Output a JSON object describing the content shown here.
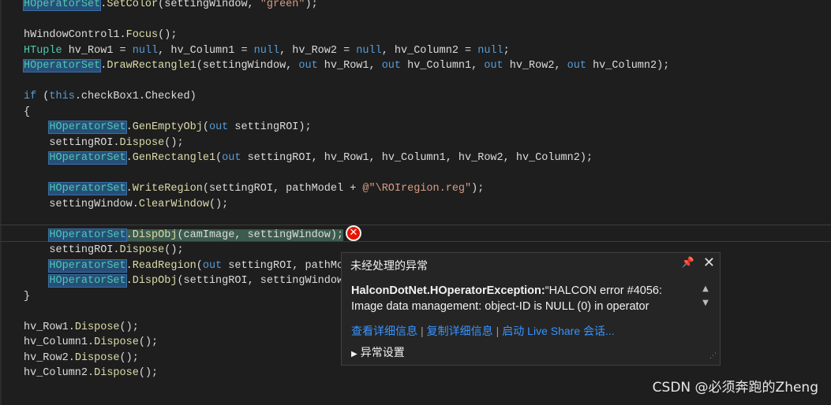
{
  "editor": {
    "lines": [
      {
        "t": [
          {
            "c": "hl-box tok-type",
            "v": "HOperatorSet"
          },
          {
            "c": "tok-plain",
            "v": "."
          },
          {
            "c": "tok-method",
            "v": "SetColor"
          },
          {
            "c": "tok-plain",
            "v": "(settingWindow, "
          },
          {
            "c": "tok-str",
            "v": "\"green\""
          },
          {
            "c": "tok-plain",
            "v": ");"
          }
        ]
      },
      {
        "t": []
      },
      {
        "t": [
          {
            "c": "tok-plain",
            "v": "hWindowControl1."
          },
          {
            "c": "tok-method",
            "v": "Focus"
          },
          {
            "c": "tok-plain",
            "v": "();"
          }
        ]
      },
      {
        "t": [
          {
            "c": "tok-type",
            "v": "HTuple"
          },
          {
            "c": "tok-plain",
            "v": " hv_Row1 = "
          },
          {
            "c": "tok-kw",
            "v": "null"
          },
          {
            "c": "tok-plain",
            "v": ", hv_Column1 = "
          },
          {
            "c": "tok-kw",
            "v": "null"
          },
          {
            "c": "tok-plain",
            "v": ", hv_Row2 = "
          },
          {
            "c": "tok-kw",
            "v": "null"
          },
          {
            "c": "tok-plain",
            "v": ", hv_Column2 = "
          },
          {
            "c": "tok-kw",
            "v": "null"
          },
          {
            "c": "tok-plain",
            "v": ";"
          }
        ]
      },
      {
        "t": [
          {
            "c": "hl-box tok-type",
            "v": "HOperatorSet"
          },
          {
            "c": "tok-plain",
            "v": "."
          },
          {
            "c": "tok-method",
            "v": "DrawRectangle1"
          },
          {
            "c": "tok-plain",
            "v": "(settingWindow, "
          },
          {
            "c": "tok-kw",
            "v": "out"
          },
          {
            "c": "tok-plain",
            "v": " hv_Row1, "
          },
          {
            "c": "tok-kw",
            "v": "out"
          },
          {
            "c": "tok-plain",
            "v": " hv_Column1, "
          },
          {
            "c": "tok-kw",
            "v": "out"
          },
          {
            "c": "tok-plain",
            "v": " hv_Row2, "
          },
          {
            "c": "tok-kw",
            "v": "out"
          },
          {
            "c": "tok-plain",
            "v": " hv_Column2);"
          }
        ]
      },
      {
        "t": []
      },
      {
        "t": [
          {
            "c": "tok-kw",
            "v": "if"
          },
          {
            "c": "tok-plain",
            "v": " ("
          },
          {
            "c": "tok-kw",
            "v": "this"
          },
          {
            "c": "tok-plain",
            "v": ".checkBox1.Checked)"
          }
        ]
      },
      {
        "t": [
          {
            "c": "tok-plain",
            "v": "{"
          }
        ]
      },
      {
        "t": [
          {
            "c": "tok-plain",
            "v": "    "
          },
          {
            "c": "hl-box tok-type",
            "v": "HOperatorSet"
          },
          {
            "c": "tok-plain",
            "v": "."
          },
          {
            "c": "tok-method",
            "v": "GenEmptyObj"
          },
          {
            "c": "tok-plain",
            "v": "("
          },
          {
            "c": "tok-kw",
            "v": "out"
          },
          {
            "c": "tok-plain",
            "v": " settingROI);"
          }
        ]
      },
      {
        "t": [
          {
            "c": "tok-plain",
            "v": "    settingROI."
          },
          {
            "c": "tok-method",
            "v": "Dispose"
          },
          {
            "c": "tok-plain",
            "v": "();"
          }
        ]
      },
      {
        "t": [
          {
            "c": "tok-plain",
            "v": "    "
          },
          {
            "c": "hl-box tok-type",
            "v": "HOperatorSet"
          },
          {
            "c": "tok-plain",
            "v": "."
          },
          {
            "c": "tok-method",
            "v": "GenRectangle1"
          },
          {
            "c": "tok-plain",
            "v": "("
          },
          {
            "c": "tok-kw",
            "v": "out"
          },
          {
            "c": "tok-plain",
            "v": " settingROI, hv_Row1, hv_Column1, hv_Row2, hv_Column2);"
          }
        ]
      },
      {
        "t": []
      },
      {
        "t": [
          {
            "c": "tok-plain",
            "v": "    "
          },
          {
            "c": "hl-box tok-type",
            "v": "HOperatorSet"
          },
          {
            "c": "tok-plain",
            "v": "."
          },
          {
            "c": "tok-method",
            "v": "WriteRegion"
          },
          {
            "c": "tok-plain",
            "v": "(settingROI, pathModel + "
          },
          {
            "c": "tok-str",
            "v": "@\"\\ROIregion.reg\""
          },
          {
            "c": "tok-plain",
            "v": ");"
          }
        ]
      },
      {
        "t": [
          {
            "c": "tok-plain",
            "v": "    settingWindow."
          },
          {
            "c": "tok-method",
            "v": "ClearWindow"
          },
          {
            "c": "tok-plain",
            "v": "();"
          }
        ]
      },
      {
        "t": []
      },
      {
        "t": [
          {
            "c": "tok-plain",
            "v": "    "
          },
          {
            "c": "hl-box tok-type",
            "v": "HOperatorSet"
          },
          {
            "c": "exec-highlight tok-plain",
            "v": "."
          },
          {
            "c": "exec-highlight tok-method",
            "v": "DispObj"
          },
          {
            "c": "exec-highlight tok-plain",
            "v": "(camImage, settingWindow);"
          }
        ]
      },
      {
        "t": [
          {
            "c": "tok-plain",
            "v": "    settingROI."
          },
          {
            "c": "tok-method",
            "v": "Dispose"
          },
          {
            "c": "tok-plain",
            "v": "();"
          }
        ]
      },
      {
        "t": [
          {
            "c": "tok-plain",
            "v": "    "
          },
          {
            "c": "hl-box tok-type",
            "v": "HOperatorSet"
          },
          {
            "c": "tok-plain",
            "v": "."
          },
          {
            "c": "tok-method",
            "v": "ReadRegion"
          },
          {
            "c": "tok-plain",
            "v": "("
          },
          {
            "c": "tok-kw",
            "v": "out"
          },
          {
            "c": "tok-plain",
            "v": " settingROI, pathMode"
          }
        ]
      },
      {
        "t": [
          {
            "c": "tok-plain",
            "v": "    "
          },
          {
            "c": "hl-box tok-type",
            "v": "HOperatorSet"
          },
          {
            "c": "tok-plain",
            "v": "."
          },
          {
            "c": "tok-method",
            "v": "DispObj"
          },
          {
            "c": "tok-plain",
            "v": "(settingROI, settingWindow)"
          }
        ]
      },
      {
        "t": [
          {
            "c": "tok-plain",
            "v": "}"
          }
        ]
      },
      {
        "t": []
      },
      {
        "t": [
          {
            "c": "tok-plain",
            "v": "hv_Row1."
          },
          {
            "c": "tok-method",
            "v": "Dispose"
          },
          {
            "c": "tok-plain",
            "v": "();"
          }
        ]
      },
      {
        "t": [
          {
            "c": "tok-plain",
            "v": "hv_Column1."
          },
          {
            "c": "tok-method",
            "v": "Dispose"
          },
          {
            "c": "tok-plain",
            "v": "();"
          }
        ]
      },
      {
        "t": [
          {
            "c": "tok-plain",
            "v": "hv_Row2."
          },
          {
            "c": "tok-method",
            "v": "Dispose"
          },
          {
            "c": "tok-plain",
            "v": "();"
          }
        ]
      },
      {
        "t": [
          {
            "c": "tok-plain",
            "v": "hv_Column2."
          },
          {
            "c": "tok-method",
            "v": "Dispose"
          },
          {
            "c": "tok-plain",
            "v": "();"
          }
        ]
      }
    ]
  },
  "error_badge": {
    "glyph": "✕",
    "icon": "error-icon",
    "color": "#e51400"
  },
  "popup": {
    "title": "未经处理的异常",
    "pin_glyph": "📌",
    "close_glyph": "✕",
    "exception_name": "HalconDotNet.HOperatorException:",
    "message": "“HALCON error #4056: Image data management: object-ID is NULL (0) in operator",
    "links": [
      "查看详细信息",
      "复制详细信息",
      "启动 Live Share 会话..."
    ],
    "separator": "|",
    "settings_label": "异常设置",
    "scroll_up_glyph": "▲",
    "scroll_down_glyph": "▼"
  },
  "watermark": "CSDN @必须奔跑的Zheng"
}
